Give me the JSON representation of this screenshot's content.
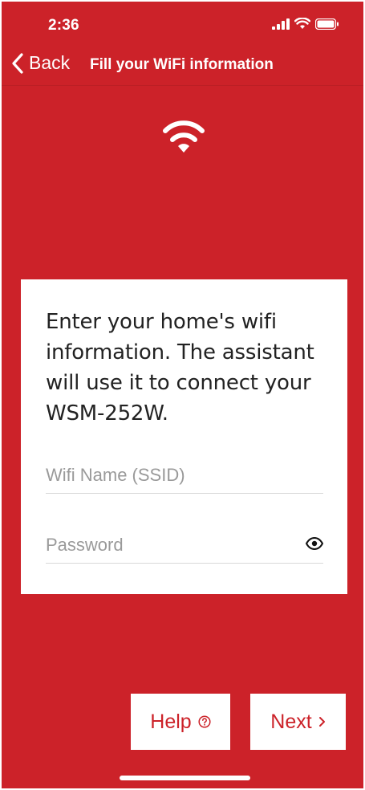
{
  "status": {
    "time": "2:36"
  },
  "nav": {
    "back_label": "Back",
    "title": "Fill your WiFi information"
  },
  "card": {
    "instructions": "Enter your home's wifi information. The assistant will use it to connect your WSM-252W.",
    "ssid_placeholder": "Wifi Name (SSID)",
    "ssid_value": "",
    "password_placeholder": "Password",
    "password_value": ""
  },
  "actions": {
    "help_label": "Help",
    "next_label": "Next"
  },
  "icons": {
    "back": "chevron-left-icon",
    "hero": "wifi-icon",
    "password_toggle": "eye-icon",
    "help": "question-circle-icon",
    "next": "chevron-right-icon"
  },
  "colors": {
    "background": "#cc2229",
    "card": "#ffffff",
    "accent": "#cc2229"
  }
}
